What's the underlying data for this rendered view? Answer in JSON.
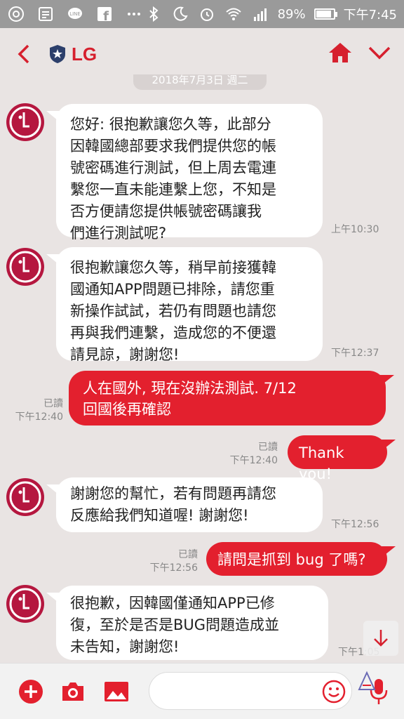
{
  "status_bar": {
    "battery": "89%",
    "battery_level": 0.89,
    "time": "下午7:45"
  },
  "header": {
    "title": "LG",
    "icons": [
      "back-chevron-icon",
      "shield-star-icon",
      "home-icon",
      "chevron-down-icon"
    ]
  },
  "date_separator": "2018年7月3日 週二",
  "messages": [
    {
      "direction": "in",
      "lines": [
        "您好: 很抱歉讓您久等，此部分",
        "因韓國總部要求我們提供您的帳",
        "號密碼進行測試，但上周去電連",
        "繫您一直未能連繫上您，不知是",
        "否方便請您提供帳號密碼讓我",
        "們進行測試呢?"
      ],
      "time": "上午10:30"
    },
    {
      "direction": "in",
      "lines": [
        "很抱歉讓您久等，稍早前接獲韓",
        "國通知APP問題已排除，請您重",
        "新操作試試，若仍有問題也請您",
        "再與我們連繫，造成您的不便還",
        "請見諒，謝謝您!"
      ],
      "time": "下午12:37"
    },
    {
      "direction": "out",
      "lines": [
        "人在國外, 現在沒辦法測試. 7/12",
        "回國後再確認"
      ],
      "read": "已讀",
      "time": "下午12:40"
    },
    {
      "direction": "out",
      "lines": [
        "Thank you!"
      ],
      "read": "已讀",
      "time": "下午12:40"
    },
    {
      "direction": "in",
      "lines": [
        "謝謝您的幫忙，若有問題再請您",
        "反應給我們知道喔! 謝謝您!"
      ],
      "time": "下午12:56"
    },
    {
      "direction": "out",
      "lines": [
        "請問是抓到 bug 了嗎?"
      ],
      "read": "已讀",
      "time": "下午12:56"
    },
    {
      "direction": "in",
      "lines": [
        "很抱歉，因韓國僅通知APP已修",
        "復，至於是否是BUG問題造成並",
        "未告知，謝謝您!"
      ],
      "time": "下午1:05"
    }
  ],
  "input_bar": {
    "placeholder": "",
    "icons": [
      "add-icon",
      "camera-icon",
      "image-icon",
      "emoji-icon",
      "microphone-icon"
    ]
  },
  "colors": {
    "accent": "#e3202e",
    "background": "#e9e4e3",
    "bubble_in": "#ffffff"
  }
}
